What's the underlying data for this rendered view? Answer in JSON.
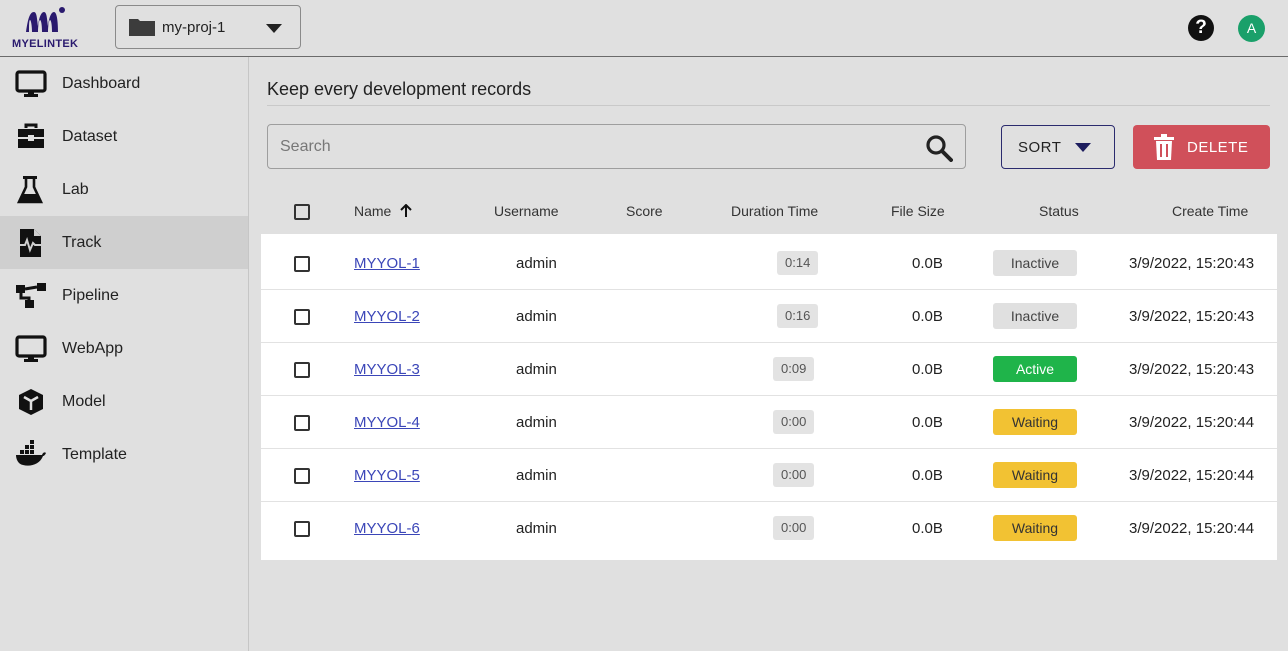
{
  "brand": {
    "logo_text": "MYELINTEK"
  },
  "project": {
    "selected": "my-proj-1"
  },
  "user": {
    "avatar_letter": "A",
    "help_glyph": "?"
  },
  "sidebar": {
    "items": [
      {
        "label": "Dashboard",
        "icon": "monitor-icon"
      },
      {
        "label": "Dataset",
        "icon": "toolbox-icon"
      },
      {
        "label": "Lab",
        "icon": "flask-icon"
      },
      {
        "label": "Track",
        "icon": "track-file-icon",
        "active": true
      },
      {
        "label": "Pipeline",
        "icon": "pipeline-icon"
      },
      {
        "label": "WebApp",
        "icon": "monitor-icon"
      },
      {
        "label": "Model",
        "icon": "cube-icon"
      },
      {
        "label": "Template",
        "icon": "docker-whale-icon"
      }
    ]
  },
  "main": {
    "title": "Keep every development records",
    "search": {
      "placeholder": "Search",
      "value": ""
    },
    "sort_label": "SORT",
    "delete_label": "DELETE"
  },
  "table": {
    "headers": {
      "name": "Name",
      "username": "Username",
      "score": "Score",
      "duration": "Duration Time",
      "file_size": "File Size",
      "status": "Status",
      "create_time": "Create Time"
    },
    "sort_indicator": "ascending",
    "rows": [
      {
        "name": "MYYOL-1",
        "username": "admin",
        "score": "",
        "duration": "0:14",
        "file_size": "0.0B",
        "status": "Inactive",
        "create_time": "3/9/2022, 15:20:43"
      },
      {
        "name": "MYYOL-2",
        "username": "admin",
        "score": "",
        "duration": "0:16",
        "file_size": "0.0B",
        "status": "Inactive",
        "create_time": "3/9/2022, 15:20:43"
      },
      {
        "name": "MYYOL-3",
        "username": "admin",
        "score": "",
        "duration": "0:09",
        "file_size": "0.0B",
        "status": "Active",
        "create_time": "3/9/2022, 15:20:43"
      },
      {
        "name": "MYYOL-4",
        "username": "admin",
        "score": "",
        "duration": "0:00",
        "file_size": "0.0B",
        "status": "Waiting",
        "create_time": "3/9/2022, 15:20:44"
      },
      {
        "name": "MYYOL-5",
        "username": "admin",
        "score": "",
        "duration": "0:00",
        "file_size": "0.0B",
        "status": "Waiting",
        "create_time": "3/9/2022, 15:20:44"
      },
      {
        "name": "MYYOL-6",
        "username": "admin",
        "score": "",
        "duration": "0:00",
        "file_size": "0.0B",
        "status": "Waiting",
        "create_time": "3/9/2022, 15:20:44"
      }
    ]
  },
  "colors": {
    "brand": "#2a1a6e",
    "avatar": "#1aa06a",
    "delete": "#d0505a",
    "status_inactive": "#e0e0e0",
    "status_active": "#1fb44a",
    "status_waiting": "#f2c233"
  }
}
